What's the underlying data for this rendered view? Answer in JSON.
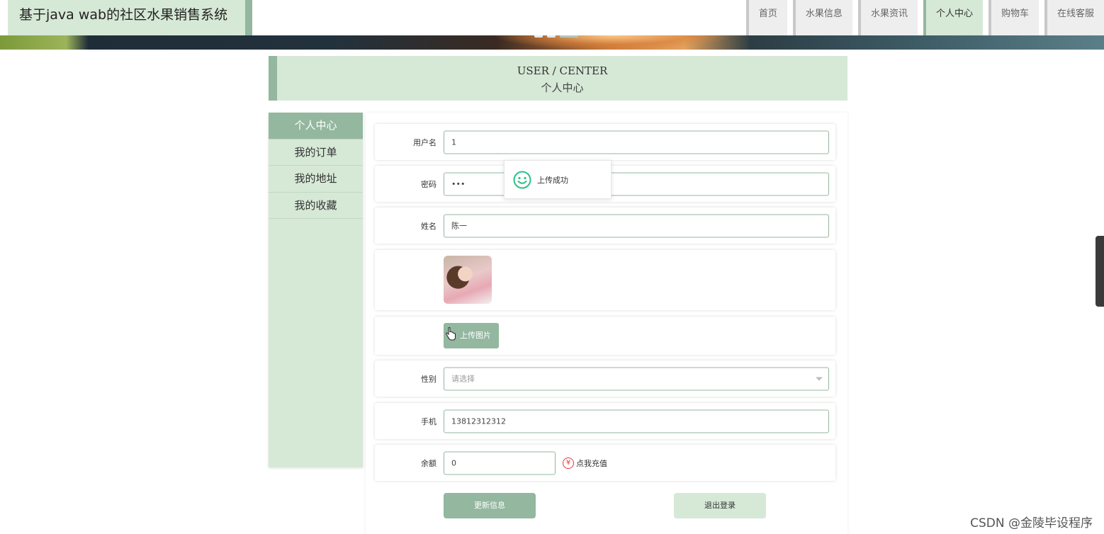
{
  "site": {
    "title": "基于java wab的社区水果销售系统"
  },
  "nav": {
    "items": [
      {
        "label": "首页"
      },
      {
        "label": "水果信息"
      },
      {
        "label": "水果资讯"
      },
      {
        "label": "个人中心"
      },
      {
        "label": "购物车"
      },
      {
        "label": "在线客服"
      }
    ],
    "active": "个人中心"
  },
  "section": {
    "title_en": "USER / CENTER",
    "title_cn": "个人中心"
  },
  "sidebar": {
    "items": [
      {
        "label": "个人中心"
      },
      {
        "label": "我的订单"
      },
      {
        "label": "我的地址"
      },
      {
        "label": "我的收藏"
      }
    ],
    "active": "个人中心"
  },
  "form": {
    "username": {
      "label": "用户名",
      "value": "1"
    },
    "password": {
      "label": "密码",
      "value": "•••"
    },
    "name": {
      "label": "姓名",
      "value": "陈一"
    },
    "upload": {
      "button_label": "上传图片"
    },
    "gender": {
      "label": "性别",
      "placeholder": "请选择"
    },
    "phone": {
      "label": "手机",
      "value": "13812312312"
    },
    "balance": {
      "label": "余额",
      "value": "0",
      "recharge_label": "点我充值",
      "recharge_icon": "¥"
    }
  },
  "actions": {
    "update_label": "更新信息",
    "logout_label": "退出登录"
  },
  "toast": {
    "message": "上传成功"
  },
  "watermark": {
    "text": "CSDN @金陵毕设程序"
  },
  "colors": {
    "accent": "#93b79f",
    "accent_light": "#d6e8d6",
    "toast_icon": "#2fbf8a",
    "recharge_icon": "#e23b3b"
  }
}
